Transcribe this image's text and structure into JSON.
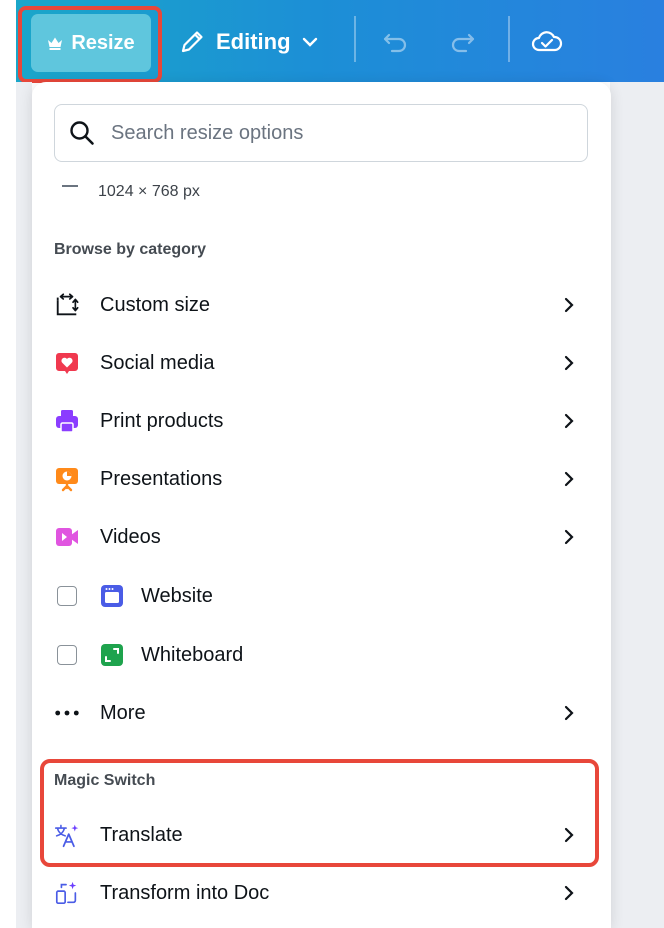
{
  "toolbar": {
    "resize_label": "Resize",
    "editing_label": "Editing"
  },
  "panel": {
    "search_placeholder": "Search resize options",
    "current_size": "1024 × 768 px",
    "browse_title": "Browse by category",
    "categories": [
      {
        "label": "Custom size",
        "icon": "custom-size-icon"
      },
      {
        "label": "Social media",
        "icon": "heart-icon",
        "color": "#f0394f"
      },
      {
        "label": "Print products",
        "icon": "printer-icon",
        "color": "#8b3dff"
      },
      {
        "label": "Presentations",
        "icon": "presentation-icon",
        "color": "#ff8a1a"
      },
      {
        "label": "Videos",
        "icon": "video-icon",
        "color": "#e055e0"
      },
      {
        "label": "Website",
        "icon": "website-icon",
        "color": "#4a5ce6"
      },
      {
        "label": "Whiteboard",
        "icon": "whiteboard-icon",
        "color": "#1ea34d"
      },
      {
        "label": "More",
        "icon": "more-dots-icon"
      }
    ],
    "magic_title": "Magic Switch",
    "magic_items": [
      {
        "label": "Translate",
        "icon": "translate-icon"
      },
      {
        "label": "Transform into Doc",
        "icon": "transform-doc-icon"
      }
    ]
  },
  "colors": {
    "accent": "#1c8fd6",
    "highlight": "#e8473a"
  }
}
